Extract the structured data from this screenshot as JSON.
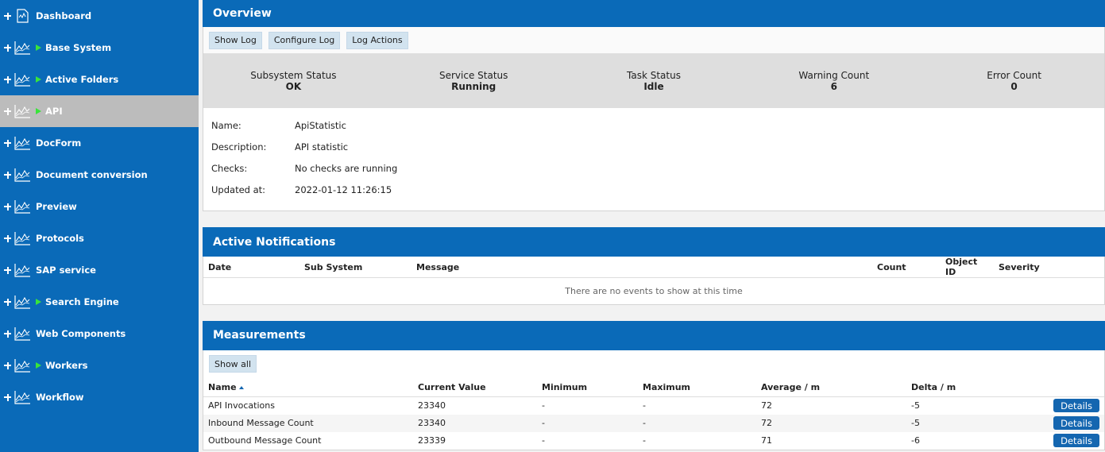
{
  "sidebar": {
    "items": [
      {
        "label": "Dashboard",
        "icon": "document-chart-icon",
        "expandable": false,
        "active": false
      },
      {
        "label": "Base System",
        "icon": "line-chart-icon",
        "expandable": true,
        "active": false
      },
      {
        "label": "Active Folders",
        "icon": "line-chart-icon",
        "expandable": true,
        "active": false
      },
      {
        "label": "API",
        "icon": "line-chart-icon",
        "expandable": true,
        "active": true
      },
      {
        "label": "DocForm",
        "icon": "line-chart-icon",
        "expandable": false,
        "active": false
      },
      {
        "label": "Document conversion",
        "icon": "line-chart-icon",
        "expandable": false,
        "active": false
      },
      {
        "label": "Preview",
        "icon": "line-chart-icon",
        "expandable": false,
        "active": false
      },
      {
        "label": "Protocols",
        "icon": "line-chart-icon",
        "expandable": false,
        "active": false
      },
      {
        "label": "SAP service",
        "icon": "line-chart-icon",
        "expandable": false,
        "active": false
      },
      {
        "label": "Search Engine",
        "icon": "line-chart-icon",
        "expandable": true,
        "active": false
      },
      {
        "label": "Web Components",
        "icon": "line-chart-icon",
        "expandable": false,
        "active": false
      },
      {
        "label": "Workers",
        "icon": "line-chart-icon",
        "expandable": true,
        "active": false
      },
      {
        "label": "Workflow",
        "icon": "line-chart-icon",
        "expandable": false,
        "active": false
      }
    ]
  },
  "overview": {
    "title": "Overview",
    "buttons": [
      "Show Log",
      "Configure Log",
      "Log Actions"
    ],
    "status": [
      {
        "label": "Subsystem Status",
        "value": "OK"
      },
      {
        "label": "Service Status",
        "value": "Running"
      },
      {
        "label": "Task Status",
        "value": "Idle"
      },
      {
        "label": "Warning Count",
        "value": "6"
      },
      {
        "label": "Error Count",
        "value": "0"
      }
    ],
    "info": [
      {
        "key": "Name:",
        "value": "ApiStatistic"
      },
      {
        "key": "Description:",
        "value": "API statistic"
      },
      {
        "key": "Checks:",
        "value": "No checks are running"
      },
      {
        "key": "Updated at:",
        "value": "2022-01-12 11:26:15"
      }
    ]
  },
  "notifications": {
    "title": "Active Notifications",
    "columns": [
      "Date",
      "Sub System",
      "Message",
      "Count",
      "Object ID",
      "Severity"
    ],
    "empty_text": "There are no events to show at this time"
  },
  "measurements": {
    "title": "Measurements",
    "show_all_label": "Show all",
    "columns": [
      "Name",
      "Current Value",
      "Minimum",
      "Maximum",
      "Average / m",
      "Delta / m"
    ],
    "rows": [
      {
        "name": "API Invocations",
        "current": "23340",
        "min": "-",
        "max": "-",
        "avg": "72",
        "delta": "-5",
        "action": "Details"
      },
      {
        "name": "Inbound Message Count",
        "current": "23340",
        "min": "-",
        "max": "-",
        "avg": "72",
        "delta": "-5",
        "action": "Details"
      },
      {
        "name": "Outbound Message Count",
        "current": "23339",
        "min": "-",
        "max": "-",
        "avg": "71",
        "delta": "-6",
        "action": "Details"
      }
    ]
  },
  "colors": {
    "header": "#0a6ab8",
    "active_nav": "#bcbcbc",
    "expand_arrow": "#39e43a"
  }
}
